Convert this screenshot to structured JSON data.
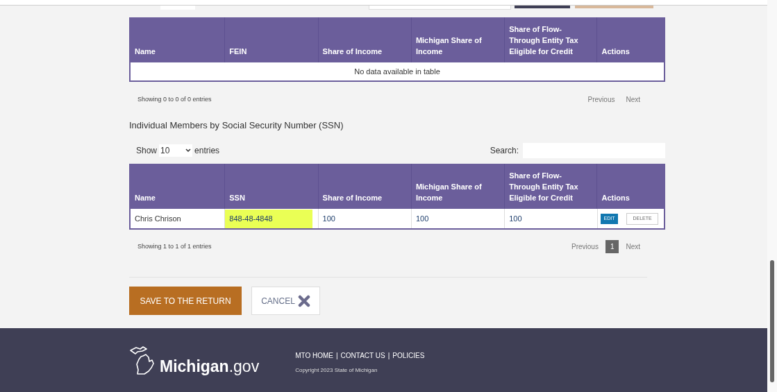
{
  "business_table": {
    "columns": [
      "Name",
      "FEIN",
      "Share of Income",
      "Michigan Share of Income",
      "Share of Flow-Through Entity Tax Eligible for Credit",
      "Actions"
    ],
    "empty_message": "No data available in table",
    "info": "Showing 0 to 0 of 0 entries",
    "pagination": [
      {
        "label": "Previous",
        "kind": "link",
        "selected": false
      },
      {
        "label": "Next",
        "kind": "link",
        "selected": false
      }
    ]
  },
  "individual_section": {
    "title": "Individual Members by Social Security Number (SSN)",
    "length": {
      "before": "Show",
      "value": "10",
      "after": "entries"
    },
    "search": {
      "label": "Search:"
    },
    "columns": [
      "Name",
      "SSN",
      "Share of Income",
      "Michigan Share of Income",
      "Share of Flow-Through Entity Tax Eligible for Credit",
      "Actions"
    ],
    "rows": [
      {
        "cells": [
          {
            "text": "Chris Chrison",
            "highlighted": false
          },
          {
            "text": "848-48-4848",
            "highlighted": true
          },
          {
            "text": "100",
            "highlighted": false
          },
          {
            "text": "100",
            "highlighted": false
          },
          {
            "text": "100",
            "highlighted": false
          }
        ],
        "actions": [
          {
            "label": "EDIT",
            "kind": "primary"
          },
          {
            "label": "DELETE",
            "kind": "outline"
          }
        ]
      }
    ],
    "info": "Showing 1 to 1 of 1 entries",
    "pagination": [
      {
        "label": "Previous",
        "kind": "link",
        "selected": false
      },
      {
        "label": "1",
        "kind": "page",
        "selected": true
      },
      {
        "label": "Next",
        "kind": "link",
        "selected": false
      }
    ]
  },
  "buttons": [
    {
      "label": "SAVE TO THE RETURN",
      "kind": "primary"
    },
    {
      "label": "CANCEL",
      "kind": "cancel"
    }
  ],
  "footer": {
    "logo": {
      "bold": "Michigan",
      "light": ".gov"
    },
    "links": [
      "MTO HOME",
      "CONTACT US",
      "POLICIES"
    ],
    "separator": "|",
    "copyright": "Copyright 2023 State of Michigan"
  }
}
